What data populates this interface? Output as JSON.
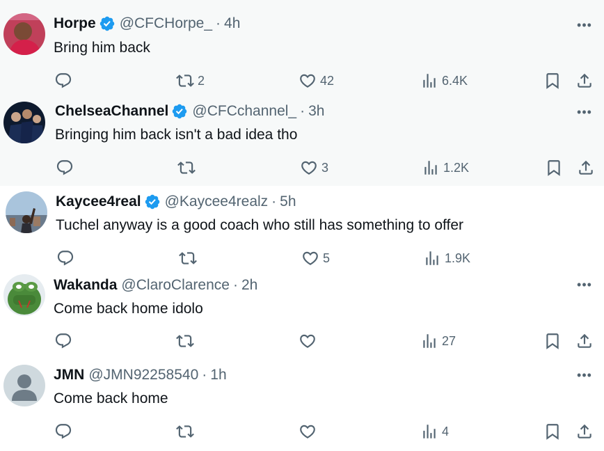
{
  "colors": {
    "verified": "#1d9bf0",
    "text": "#0f1419",
    "secondary": "#536471",
    "shaded_bg": "#f7f9f9"
  },
  "icons": {
    "reply": "reply-icon",
    "retweet": "retweet-icon",
    "like": "heart-icon",
    "views": "views-bars-icon",
    "bookmark": "bookmark-icon",
    "share": "share-icon",
    "more": "more-dots-icon",
    "verified": "verified-badge-icon"
  },
  "tweets": [
    {
      "name": "Horpe",
      "handle": "@CFCHorpe_",
      "dot": "·",
      "time": "4h",
      "verified": true,
      "text": "Bring him back",
      "replies": "",
      "retweets": "2",
      "likes": "42",
      "views": "6.4K",
      "more": "•••"
    },
    {
      "name": "ChelseaChannel",
      "handle": "@CFCchannel_",
      "dot": "·",
      "time": "3h",
      "verified": true,
      "text": "Bringing him back isn't a bad idea tho",
      "replies": "",
      "retweets": "",
      "likes": "3",
      "views": "1.2K",
      "more": "•••"
    },
    {
      "name": "Kaycee4real",
      "handle": "@Kaycee4realz",
      "dot": "·",
      "time": "5h",
      "verified": true,
      "text": "Tuchel anyway is a good coach who still has something to offer",
      "replies": "",
      "retweets": "",
      "likes": "5",
      "views": "1.9K"
    },
    {
      "name": "Wakanda",
      "handle": "@ClaroClarence",
      "dot": "·",
      "time": "2h",
      "verified": false,
      "text": "Come back home idolo",
      "replies": "",
      "retweets": "",
      "likes": "",
      "views": "27",
      "more": "•••"
    },
    {
      "name": "JMN",
      "handle": "@JMN92258540",
      "dot": "·",
      "time": "1h",
      "verified": false,
      "text": "Come back home",
      "replies": "",
      "retweets": "",
      "likes": "",
      "views": "4",
      "more": "•••"
    }
  ]
}
